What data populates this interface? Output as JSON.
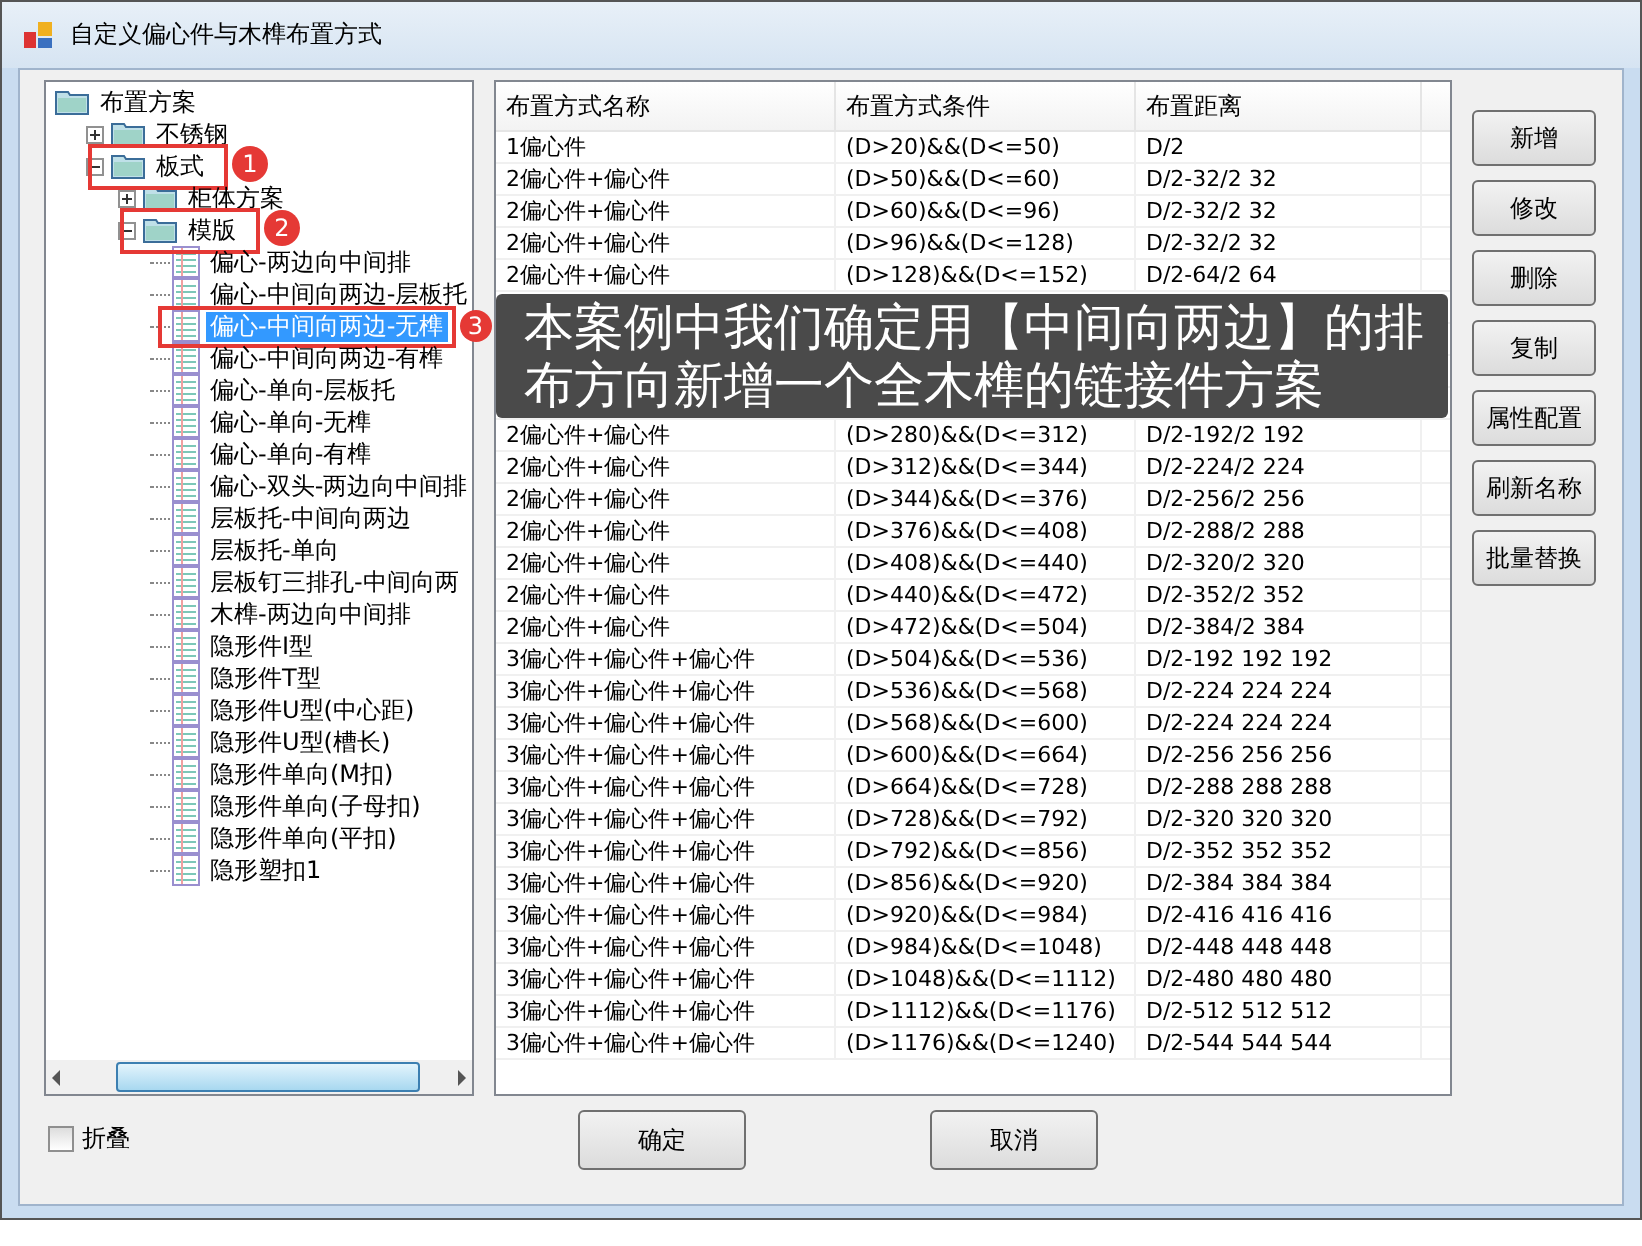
{
  "window": {
    "title": "自定义偏心件与木榫布置方式"
  },
  "tree": {
    "label": "布置方案",
    "kind": "folder",
    "selected": false,
    "children": [
      {
        "label": "不锈钢",
        "kind": "folder",
        "expanded": false,
        "selected": false
      },
      {
        "label": "板式",
        "kind": "folder",
        "expanded": true,
        "selected": false,
        "annotation": "1",
        "children": [
          {
            "label": "柜体方案",
            "kind": "folder",
            "expanded": false,
            "selected": false
          },
          {
            "label": "模版",
            "kind": "folder",
            "expanded": true,
            "selected": false,
            "annotation": "2",
            "children": [
              {
                "label": "偏心-两边向中间排",
                "kind": "item",
                "selected": false
              },
              {
                "label": "偏心-中间向两边-层板托",
                "kind": "item",
                "selected": false
              },
              {
                "label": "偏心-中间向两边-无榫",
                "kind": "item",
                "selected": true,
                "annotation": "3"
              },
              {
                "label": "偏心-中间向两边-有榫",
                "kind": "item",
                "selected": false
              },
              {
                "label": "偏心-单向-层板托",
                "kind": "item",
                "selected": false
              },
              {
                "label": "偏心-单向-无榫",
                "kind": "item",
                "selected": false
              },
              {
                "label": "偏心-单向-有榫",
                "kind": "item",
                "selected": false
              },
              {
                "label": "偏心-双头-两边向中间排",
                "kind": "item",
                "selected": false
              },
              {
                "label": "层板托-中间向两边",
                "kind": "item",
                "selected": false
              },
              {
                "label": "层板托-单向",
                "kind": "item",
                "selected": false
              },
              {
                "label": "层板钉三排孔-中间向两",
                "kind": "item",
                "selected": false
              },
              {
                "label": "木榫-两边向中间排",
                "kind": "item",
                "selected": false
              },
              {
                "label": "隐形件I型",
                "kind": "item",
                "selected": false
              },
              {
                "label": "隐形件T型",
                "kind": "item",
                "selected": false
              },
              {
                "label": "隐形件U型(中心距)",
                "kind": "item",
                "selected": false
              },
              {
                "label": "隐形件U型(槽长)",
                "kind": "item",
                "selected": false
              },
              {
                "label": "隐形件单向(M扣)",
                "kind": "item",
                "selected": false
              },
              {
                "label": "隐形件单向(子母扣)",
                "kind": "item",
                "selected": false
              },
              {
                "label": "隐形件单向(平扣)",
                "kind": "item",
                "selected": false
              },
              {
                "label": "隐形塑扣1",
                "kind": "item",
                "selected": false
              }
            ]
          }
        ]
      }
    ]
  },
  "collapse_checkbox": {
    "label": "折叠",
    "checked": false
  },
  "table": {
    "columns": [
      "布置方式名称",
      "布置方式条件",
      "布置距离"
    ],
    "rows": [
      {
        "cells": [
          "1偏心件",
          "(D>20)&&(D<=50)",
          "D/2"
        ]
      },
      {
        "cells": [
          "2偏心件+偏心件",
          "(D>50)&&(D<=60)",
          "D/2-32/2 32"
        ]
      },
      {
        "cells": [
          "2偏心件+偏心件",
          "(D>60)&&(D<=96)",
          "D/2-32/2 32"
        ]
      },
      {
        "cells": [
          "2偏心件+偏心件",
          "(D>96)&&(D<=128)",
          "D/2-32/2 32"
        ]
      },
      {
        "cells": [
          "2偏心件+偏心件",
          "(D>128)&&(D<=152)",
          "D/2-64/2 64"
        ]
      },
      {},
      {},
      {},
      {},
      {
        "cells": [
          "2偏心件+偏心件",
          "(D>280)&&(D<=312)",
          "D/2-192/2 192"
        ]
      },
      {
        "cells": [
          "2偏心件+偏心件",
          "(D>312)&&(D<=344)",
          "D/2-224/2 224"
        ]
      },
      {
        "cells": [
          "2偏心件+偏心件",
          "(D>344)&&(D<=376)",
          "D/2-256/2 256"
        ]
      },
      {
        "cells": [
          "2偏心件+偏心件",
          "(D>376)&&(D<=408)",
          "D/2-288/2 288"
        ]
      },
      {
        "cells": [
          "2偏心件+偏心件",
          "(D>408)&&(D<=440)",
          "D/2-320/2 320"
        ]
      },
      {
        "cells": [
          "2偏心件+偏心件",
          "(D>440)&&(D<=472)",
          "D/2-352/2 352"
        ]
      },
      {
        "cells": [
          "2偏心件+偏心件",
          "(D>472)&&(D<=504)",
          "D/2-384/2 384"
        ]
      },
      {
        "cells": [
          "3偏心件+偏心件+偏心件",
          "(D>504)&&(D<=536)",
          "D/2-192 192 192"
        ]
      },
      {
        "cells": [
          "3偏心件+偏心件+偏心件",
          "(D>536)&&(D<=568)",
          "D/2-224 224 224"
        ]
      },
      {
        "cells": [
          "3偏心件+偏心件+偏心件",
          "(D>568)&&(D<=600)",
          "D/2-224 224 224"
        ]
      },
      {
        "cells": [
          "3偏心件+偏心件+偏心件",
          "(D>600)&&(D<=664)",
          "D/2-256 256 256"
        ]
      },
      {
        "cells": [
          "3偏心件+偏心件+偏心件",
          "(D>664)&&(D<=728)",
          "D/2-288 288 288"
        ]
      },
      {
        "cells": [
          "3偏心件+偏心件+偏心件",
          "(D>728)&&(D<=792)",
          "D/2-320 320 320"
        ]
      },
      {
        "cells": [
          "3偏心件+偏心件+偏心件",
          "(D>792)&&(D<=856)",
          "D/2-352 352 352"
        ]
      },
      {
        "cells": [
          "3偏心件+偏心件+偏心件",
          "(D>856)&&(D<=920)",
          "D/2-384 384 384"
        ]
      },
      {
        "cells": [
          "3偏心件+偏心件+偏心件",
          "(D>920)&&(D<=984)",
          "D/2-416 416 416"
        ]
      },
      {
        "cells": [
          "3偏心件+偏心件+偏心件",
          "(D>984)&&(D<=1048)",
          "D/2-448 448 448"
        ]
      },
      {
        "cells": [
          "3偏心件+偏心件+偏心件",
          "(D>1048)&&(D<=1112)",
          "D/2-480 480 480"
        ]
      },
      {
        "cells": [
          "3偏心件+偏心件+偏心件",
          "(D>1112)&&(D<=1176)",
          "D/2-512 512 512"
        ]
      },
      {
        "cells": [
          "3偏心件+偏心件+偏心件",
          "(D>1176)&&(D<=1240)",
          "D/2-544 544 544"
        ]
      }
    ]
  },
  "side_buttons": [
    "新增",
    "修改",
    "删除",
    "复制",
    "属性配置",
    "刷新名称",
    "批量替换"
  ],
  "bottom_buttons": [
    "确定",
    "取消"
  ],
  "caption": {
    "lines": [
      "本案例中我们确定用【中间向两边】的排",
      "布方向新增一个全木榫的链接件方案"
    ]
  }
}
